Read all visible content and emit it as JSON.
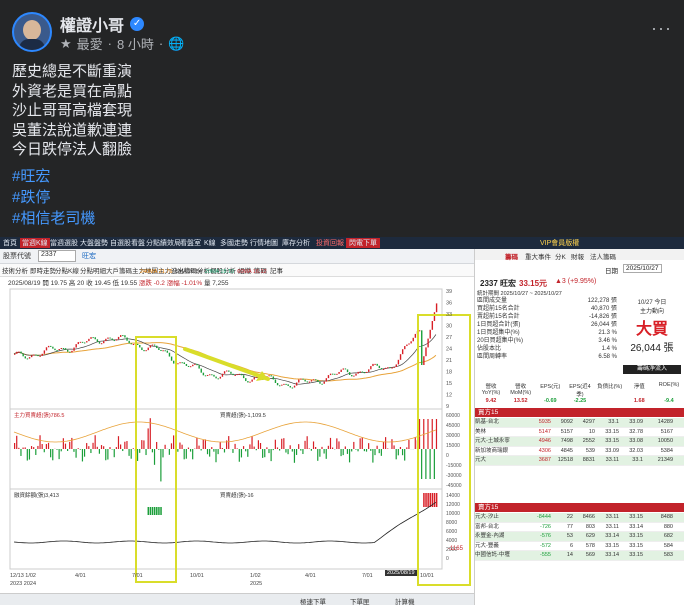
{
  "post": {
    "author": "權證小哥",
    "meta_sort": "最愛",
    "meta_time": "8 小時",
    "lines": [
      "歷史總是不斷重演",
      "外資老是買在高點",
      "沙止哥哥高檔套現",
      "吳董法說道歉連連",
      "今日跌停法人翻臉"
    ],
    "hashtags": [
      "#旺宏",
      "#跌停",
      "#相信老司機"
    ]
  },
  "app": {
    "top_menu": [
      "首頁",
      "當週K線",
      "當週選股",
      "大盤盤勢",
      "自選股看盤",
      "分點績效局",
      "看盤室",
      "K線",
      "多國走勢",
      "行情地圖",
      "庫存分析",
      "投資回報",
      "閃電下單"
    ],
    "vip_label": "VIP會員版權",
    "search_label": "股票代號",
    "stock_code": "2337",
    "stock_name": "旺宏",
    "sub_tabs": [
      "技術分析",
      "即時走勢",
      "分點K線",
      "分點明細",
      "大戶籌碼",
      "主力地圖",
      "主力進出",
      "籌碼分析",
      "個股分析",
      "組織",
      "籌碼",
      "記事"
    ],
    "chart_info": {
      "date": "2025/08/19",
      "open": "開 19.75",
      "high": "高 20",
      "close": "收 19.45",
      "low": "低 19.55",
      "change": "漲跌 -0.2",
      "pct": "漲幅 -1.01%",
      "vol": "量 7,255",
      "ma_labels": [
        "240MA 21.76",
        "5MA 20.54",
        "20MA 18.10",
        "60MA 16.12"
      ],
      "sub1_label": "主力買賣超(張)786.5",
      "sub1_value": "買賣超(張)-1,109.5",
      "sub2_label": "融資餘額(張)3,413",
      "sub2_value": "買賣超(張)-16",
      "price_top": "38.95",
      "left_val": "20.96",
      "bottom_val": "-1165",
      "highlight_date": "2025/08/19"
    },
    "x_ticks": [
      "12/13 1/02",
      "4/01",
      "7/01",
      "10/01",
      "1/02",
      "4/01",
      "7/01",
      "10/01"
    ],
    "x_years": [
      "2023 2024",
      "2025"
    ],
    "y_ticks_price": [
      "39",
      "36",
      "33",
      "30",
      "27",
      "24",
      "21",
      "18",
      "15",
      "12",
      "9"
    ],
    "y_ticks_sub": [
      "60000",
      "45000",
      "30000",
      "15000",
      "0",
      "-15000",
      "-30000",
      "-45000"
    ],
    "y_ticks_sub2": [
      "14000",
      "12000",
      "10000",
      "8000",
      "6000",
      "4000",
      "2000",
      "0"
    ],
    "status_buttons": [
      "極速下單",
      "下單匣",
      "計算機"
    ],
    "right": {
      "tabs": [
        "籌碼",
        "重大事件",
        "分K",
        "財報",
        "法人籌碼"
      ],
      "stock_line": "2337 旺宏",
      "price": "33.15元",
      "change": "▲3 (+9.95%)",
      "date_label": "日期",
      "date": "2025/10/27",
      "range": "統計期間 2025/10/27 ~ 2025/10/27",
      "stats": [
        [
          "區間成交量",
          "122,278 張"
        ],
        [
          "買超前15名合計",
          "40,870 張"
        ],
        [
          "賣超前15名合計",
          "-14,826 張"
        ],
        [
          "1日買超合計(張)",
          "26,044 張"
        ],
        [
          "1日買超集中(%)",
          "21.3 %"
        ],
        [
          "20日買超集中(%)",
          "3.46 %"
        ],
        [
          "佔股本比",
          "1.4 %"
        ],
        [
          "區間周轉率",
          "6.58 %"
        ]
      ],
      "big_label": "大買",
      "big_value": "26,044 張",
      "big_sub": "10/27 今日",
      "mainforce": "主力動向",
      "net_label": "籌碼淨流入",
      "indicators": [
        "營收 YoY(%)",
        "營收 MoM(%)",
        "EPS(元)",
        "EPS(近4季)",
        "負債比(%)",
        "淨值",
        "ROE(%)"
      ],
      "ind_values": [
        "9.42",
        "13.52",
        "-0.69",
        "-2.25",
        "",
        "1.68",
        "-9.4"
      ],
      "buy_header": "買方15",
      "sell_header": "賣方15",
      "broker_label": "券商名稱",
      "buyers": [
        [
          "凱基-台北",
          "5935",
          "9092",
          "4297",
          "33.1",
          "33.09",
          "14289"
        ],
        [
          "美林",
          "5147",
          "5157",
          "10",
          "33.15",
          "32.78",
          "5167"
        ],
        [
          "元大-土城永寧",
          "4946",
          "7498",
          "2552",
          "33.15",
          "33.08",
          "10050"
        ],
        [
          "新加坡商瑞銀",
          "4306",
          "4845",
          "539",
          "33.09",
          "32.03",
          "5384"
        ],
        [
          "元大",
          "3687",
          "12518",
          "8831",
          "33.11",
          "33.1",
          "21349"
        ]
      ],
      "sellers": [
        [
          "元大-汐止",
          "-8444",
          "22",
          "8466",
          "33.11",
          "33.15",
          "8488"
        ],
        [
          "富邦-台北",
          "-726",
          "77",
          "803",
          "33.11",
          "33.14",
          "880"
        ],
        [
          "永豐金-內湖",
          "-576",
          "53",
          "629",
          "33.14",
          "33.15",
          "682"
        ],
        [
          "元大-豐義",
          "-572",
          "6",
          "578",
          "33.15",
          "33.15",
          "584"
        ],
        [
          "中國信託-中壢",
          "-555",
          "14",
          "569",
          "33.14",
          "33.15",
          "583"
        ]
      ]
    }
  },
  "chart_data": {
    "type": "line",
    "title": "",
    "xlabel": "",
    "ylabel": "",
    "x": [
      "2023/12",
      "2024/01",
      "2024/04",
      "2024/07",
      "2024/10",
      "2025/01",
      "2025/04",
      "2025/07",
      "2025/08",
      "2025/10"
    ],
    "series": [
      {
        "name": "",
        "values": [
          22,
          24,
          27,
          24,
          18,
          17,
          15,
          18,
          19.45,
          33.15
        ]
      }
    ],
    "ylim": [
      9,
      39
    ]
  }
}
